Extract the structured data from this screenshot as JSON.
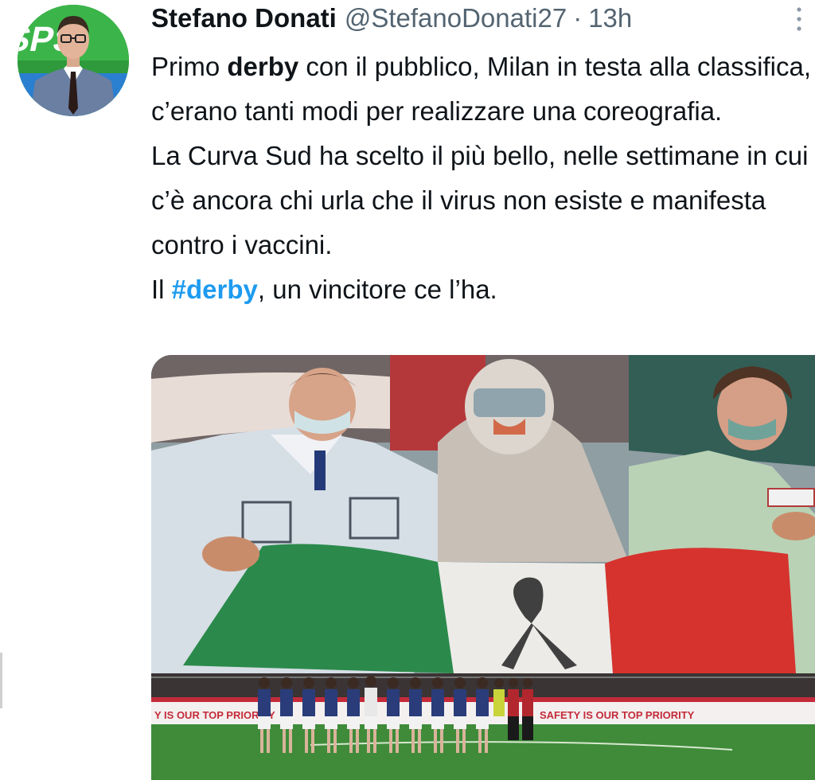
{
  "author": {
    "display_name": "Stefano Donati",
    "handle": "@StefanoDonati27",
    "separator": "·",
    "time": "13h"
  },
  "tweet": {
    "p1_a": "Primo ",
    "p1_bold": "derby",
    "p1_b": " con il pubblico, Milan in testa alla classifica, c’erano tanti modi per realizzare una coreografia.",
    "p2": "La Curva Sud ha scelto il più bello, nelle settimane in cui c’è ancora chi urla che il virus non esiste e manifesta contro i vaccini.",
    "p3_a": "Il ",
    "p3_hashtag": "#derby",
    "p3_b": ", un vincitore ce l’ha."
  },
  "media": {
    "ad_board_left": "Y IS OUR TOP PRIORITY",
    "ad_board_right": "SAFETY IS OUR TOP PRIORITY"
  },
  "icons": {
    "more": "more-vertical-icon",
    "avatar": "avatar-photo"
  },
  "colors": {
    "hashtag": "#1d9bf0",
    "secondary_text": "#536471",
    "primary_text": "#0f1419"
  }
}
